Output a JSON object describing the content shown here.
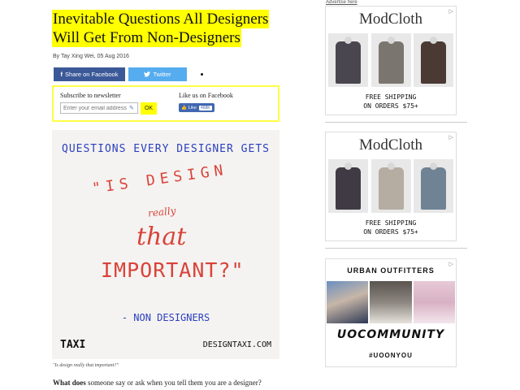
{
  "article": {
    "title_line1": "Inevitable Questions All Designers",
    "title_line2": "Will Get From Non-Designers",
    "byline": "By Tay Xing Wei, 05 Aug 2016",
    "share_facebook": "Share on Facebook",
    "share_twitter": "Twitter",
    "facebook_icon": "f",
    "twitter_icon": "bird-icon",
    "subscribe_label": "Subscribe to newsletter",
    "email_placeholder": "Enter your email address",
    "ok_label": "OK",
    "like_label": "Like us on Facebook",
    "like_button": "Like",
    "like_count": "468K",
    "image_caption": "\"Is design really that important?\"",
    "body_bold": "What does",
    "body_rest": " someone say or ask when you tell them you are a designer?"
  },
  "artwork": {
    "heading": "QUESTIONS EVERY DESIGNER GETS",
    "quote_part1": "\"IS DESIGN",
    "quote_part2": "really",
    "quote_part3": "that",
    "quote_part4": "IMPORTANT?\"",
    "attribution": "- NON DESIGNERS",
    "brand": "TAXI",
    "site": "DESIGNTAXI.COM",
    "colors": {
      "blue": "#2b3fbf",
      "red": "#d9433a"
    }
  },
  "sidebar": {
    "advertise_link": "Advertise here",
    "ads": [
      {
        "brand": "ModCloth",
        "promo_line1": "FREE SHIPPING",
        "promo_line2": "ON ORDERS $75+",
        "product_colors": [
          "#4a4650",
          "#7b7570",
          "#4a3a33"
        ]
      },
      {
        "brand": "ModCloth",
        "promo_line1": "FREE SHIPPING",
        "promo_line2": "ON ORDERS $75+",
        "product_colors": [
          "#3f3a44",
          "#b5aca2",
          "#6f8394"
        ]
      }
    ],
    "urban": {
      "brand": "URBAN OUTFITTERS",
      "tagline": "UOCOMMUNITY",
      "hashtag": "#UOONYOU"
    }
  }
}
